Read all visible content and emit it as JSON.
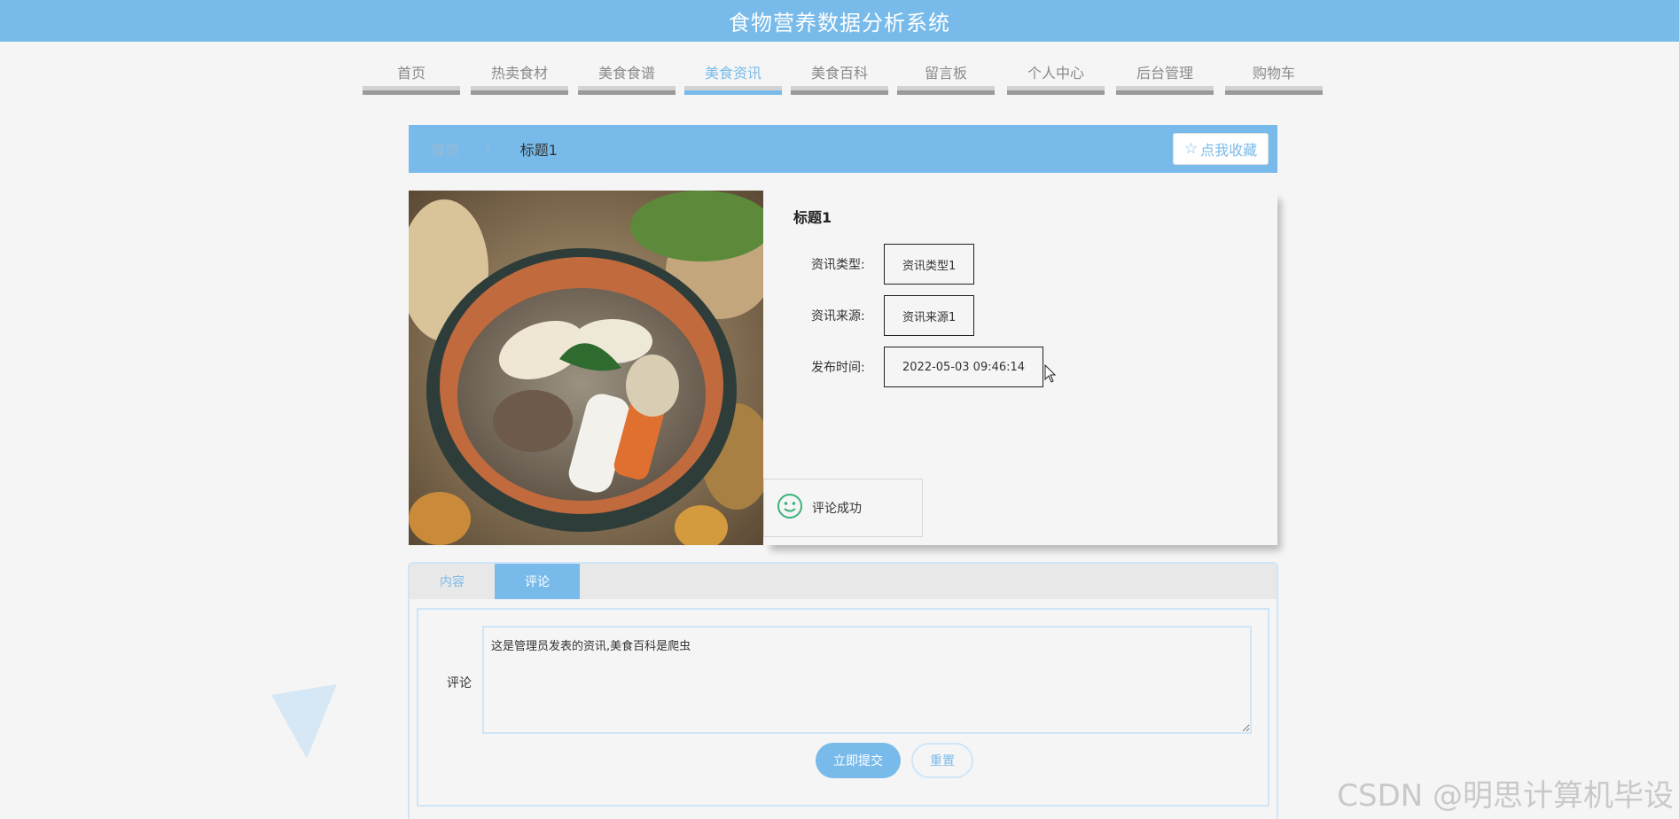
{
  "header": {
    "title": "食物营养数据分析系统"
  },
  "nav": {
    "items": [
      {
        "label": "首页",
        "active": false
      },
      {
        "label": "热卖食材",
        "active": false
      },
      {
        "label": "美食食谱",
        "active": false
      },
      {
        "label": "美食资讯",
        "active": true
      },
      {
        "label": "美食百科",
        "active": false
      },
      {
        "label": "留言板",
        "active": false
      },
      {
        "label": "个人中心",
        "active": false
      },
      {
        "label": "后台管理",
        "active": false
      },
      {
        "label": "购物车",
        "active": false
      }
    ]
  },
  "breadcrumb": {
    "home": "首页",
    "separator": "/",
    "current": "标题1"
  },
  "favorite": {
    "label": "点我收藏",
    "icon": "star-outline-icon"
  },
  "detail": {
    "title": "标题1",
    "fields": [
      {
        "label": "资讯类型:",
        "value": "资讯类型1"
      },
      {
        "label": "资讯来源:",
        "value": "资讯来源1"
      },
      {
        "label": "发布时间:",
        "value": "2022-05-03 09:46:14"
      }
    ]
  },
  "toast": {
    "message": "评论成功",
    "icon": "smile-icon"
  },
  "tabs": [
    {
      "label": "内容",
      "active": false
    },
    {
      "label": "评论",
      "active": true
    }
  ],
  "comment_form": {
    "label": "评论",
    "value": "这是管理员发表的资讯,美食百科是爬虫",
    "submit_label": "立即提交",
    "reset_label": "重置"
  },
  "watermark": "CSDN @明思计算机毕设",
  "colors": {
    "accent": "#78bbea",
    "border_light": "#cfe6f8",
    "background": "#f5f5f5"
  }
}
